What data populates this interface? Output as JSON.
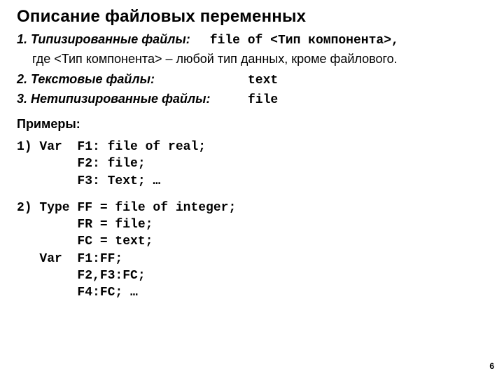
{
  "title": "Описание файловых переменных",
  "sec1": {
    "label": "1. Типизированные файлы:",
    "code": "file of <Тип компонента>,",
    "note": "где  <Тип компонента> – любой тип данных, кроме файлового."
  },
  "sec2": {
    "label": "2. Текстовые файлы:",
    "code": "text"
  },
  "sec3": {
    "label": "3. Нетипизированные файлы:",
    "code": "file"
  },
  "examples_label": "Примеры:",
  "ex1": "1) Var  F1: file of real;\n        F2: file;\n        F3: Text; …",
  "ex2": "2) Type FF = file of integer;\n        FR = file;\n        FC = text;\n   Var  F1:FF;\n        F2,F3:FC;\n        F4:FC; …",
  "page_number": "6"
}
